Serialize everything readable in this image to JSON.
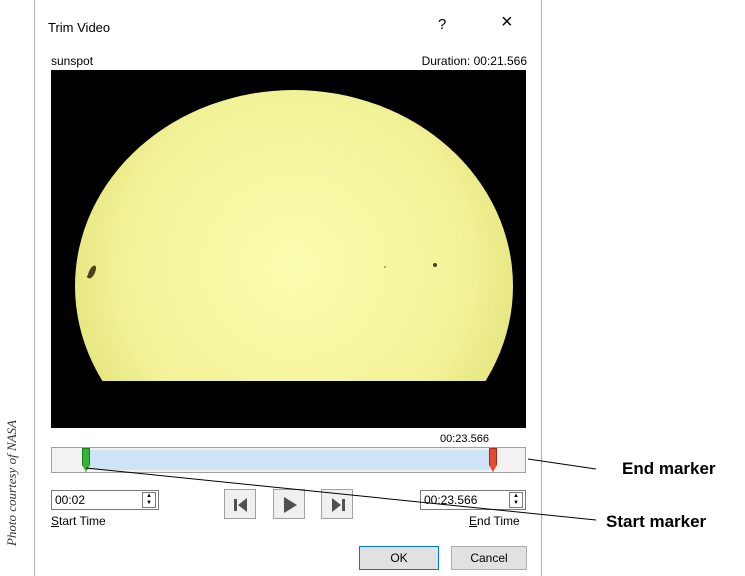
{
  "credit": "Photo courtesy of NASA",
  "dialog": {
    "title": "Trim Video",
    "help": "?",
    "close": "×",
    "video_name": "sunspot",
    "duration": "Duration: 00:21.566",
    "end_time_display": "00:23.566",
    "start_time": {
      "value": "00:02",
      "label_prefix": "S",
      "label_rest": "tart Time"
    },
    "end_time": {
      "value": "00:23.566",
      "label_prefix": "E",
      "label_rest": "nd Time"
    },
    "buttons": {
      "ok": "OK",
      "cancel": "Cancel"
    },
    "colors": {
      "selection": "#cfe3f6",
      "start_marker": "#35b535",
      "end_marker": "#e24a33"
    }
  },
  "callouts": {
    "end_marker": "End marker",
    "start_marker": "Start marker"
  },
  "icons": {
    "previous_frame": "previous-frame-icon",
    "play": "play-icon",
    "next_frame": "next-frame-icon"
  }
}
